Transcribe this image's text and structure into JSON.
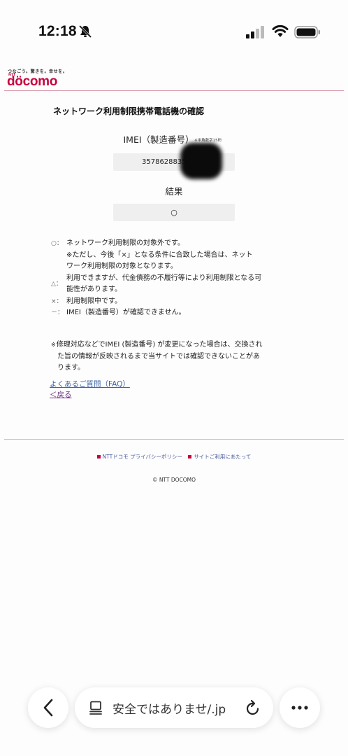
{
  "status_bar": {
    "time": "12:18",
    "icons": [
      "bell-slash-icon",
      "signal-icon",
      "wifi-icon",
      "battery-icon"
    ]
  },
  "header": {
    "tagline": "つなごう。驚きを。幸せを。",
    "ntt": "NTT",
    "logo": "döcomo",
    "brand_color": "#c8003f"
  },
  "content": {
    "page_title": "ネットワーク利用制限携帯電話機の確認",
    "imei_label": "IMEI（製造番号）",
    "imei_note": "※半角数字15桁",
    "imei_value": "3578628835",
    "result_label": "結果",
    "result_value": "○",
    "legend": [
      {
        "symbol": "○：",
        "text": "ネットワーク利用制限の対象外です。"
      },
      {
        "symbol": "",
        "text": "※ただし、今後「×」となる条件に合致した場合は、ネット"
      },
      {
        "symbol": "",
        "text": "ワーク利用制限の対象となります。"
      },
      {
        "symbol": "",
        "text": "利用できますが、代金債務の不履行等により利用制限となる可"
      },
      {
        "symbol": "△：",
        "text": "能性があります。"
      },
      {
        "symbol": "×：",
        "text": "利用制限中です。"
      },
      {
        "symbol": "－：",
        "text": "IMEI（製造番号）が確認できません。"
      }
    ],
    "note": [
      "※",
      "修理対応などでIMEI (製造番号) が変更になった場合は、交換され",
      "た旨の情報が反映されるまで当サイトでは確認できないことがあ",
      "ります。"
    ],
    "faq_link": "よくあるご質問（FAQ）",
    "back_link": "＜戻る"
  },
  "footer": {
    "links": [
      "NTTドコモ プライバシーポリシー",
      "サイトご利用にあたって"
    ],
    "copyright": "© NTT DOCOMO"
  },
  "browser_bar": {
    "address_text": "安全ではありませ/.jp",
    "icons": [
      "chevron-left-icon",
      "page-icon",
      "reload-icon",
      "more-icon"
    ]
  }
}
